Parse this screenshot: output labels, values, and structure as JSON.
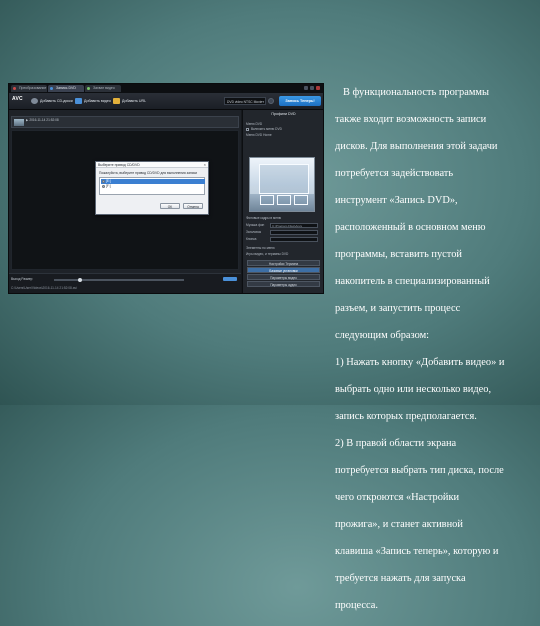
{
  "app": {
    "logo": "AVC",
    "tabs": [
      "Преобразование",
      "Запись DVD",
      "Захват видео"
    ],
    "toolbar": {
      "add_cd": "Добавить CD-диски",
      "add_video": "Добавить видео",
      "add_url": "Добавить URL",
      "profile": "DVD video NTSC Movie",
      "record": "Запись Теперь!"
    },
    "file_row": "▶ 2016-11-14 21:52:08",
    "bottom": {
      "label": "Выход Размер",
      "path": "C:\\Users\\User\\Videos\\2016-11-14 21:52:08.avi"
    },
    "right": {
      "title": "Профили DVD",
      "lines": [
        "Меню DVD",
        "Включить меню DVD",
        "Меню DVD Home"
      ],
      "fields": [
        {
          "label": "Фоновые кадры в меню",
          "value": ""
        },
        {
          "label": "Музыка фон",
          "value": "C:\\Program Files\\Anvs"
        },
        {
          "label": "Заголовок",
          "value": ""
        },
        {
          "label": "Кнопка",
          "value": ""
        }
      ],
      "lower_lines": [
        "Элементы по меню",
        "Игры видео, и термины DVD"
      ],
      "tabs": [
        "Настройки Термина",
        "Базовые установки",
        "Параметры видео",
        "Параметры аудио"
      ]
    },
    "dialog": {
      "title": "Выберите привод CD/DVD",
      "message": "Пожалуйста, выберите привод CD/DVD для выполнения записи",
      "items": [
        "[E:]",
        "[F:]"
      ],
      "ok": "OK",
      "cancel": "Отмена"
    }
  },
  "text": {
    "lines": [
      "В функциональность программы",
      "также входит возможность записи",
      "дисков. Для выполнения этой задачи",
      "потребуется задействовать",
      "инструмент «Запись DVD»,",
      "расположенный в основном меню",
      "программы, вставить пустой",
      "накопитель в специализированный",
      "разъем, и запустить процесс",
      "следующим образом:",
      "1) Нажать кнопку «Добавить видео» и",
      "выбрать одно или несколько видео,",
      "запись которых предполагается.",
      "2) В правой области экрана",
      "потребуется выбрать тип диска, после",
      "чего откроются «Настройки",
      "прожига», и станет активной",
      "клавиша «Запись теперь», которую и",
      "требуется нажать для запуска",
      "процесса."
    ]
  },
  "colors": {
    "background": "#5f8b8a",
    "accent": "#2a82d6",
    "text": "#ffffff"
  }
}
